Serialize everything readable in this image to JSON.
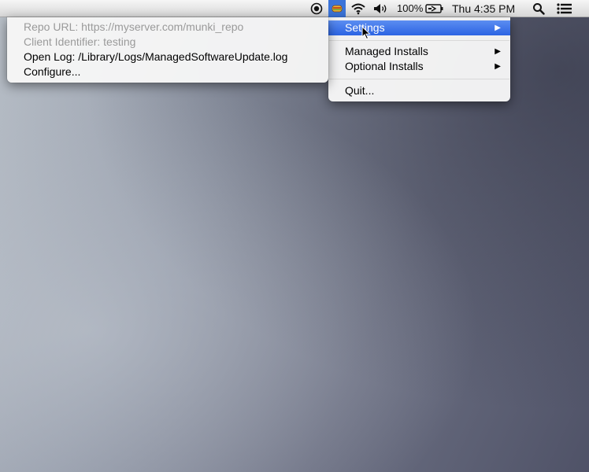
{
  "menubar": {
    "battery_percent": "100%",
    "clock": "Thu 4:35 PM",
    "icons": {
      "record": "record-icon",
      "munki": "munki-status-icon",
      "wifi": "wifi-icon",
      "volume": "volume-icon",
      "battery": "battery-icon",
      "spotlight": "spotlight-search-icon",
      "notifications": "notification-center-icon"
    },
    "highlight_color": "#3b74d9"
  },
  "main_menu": {
    "settings": "Settings",
    "managed_installs": "Managed Installs",
    "optional_installs": "Optional Installs",
    "quit": "Quit...",
    "submenu_arrow": "▶"
  },
  "settings_menu": {
    "repo_url": "Repo URL: https://myserver.com/munki_repo",
    "client_identifier": "Client Identifier: testing",
    "open_log": "Open Log: /Library/Logs/ManagedSoftwareUpdate.log",
    "configure": "Configure..."
  }
}
